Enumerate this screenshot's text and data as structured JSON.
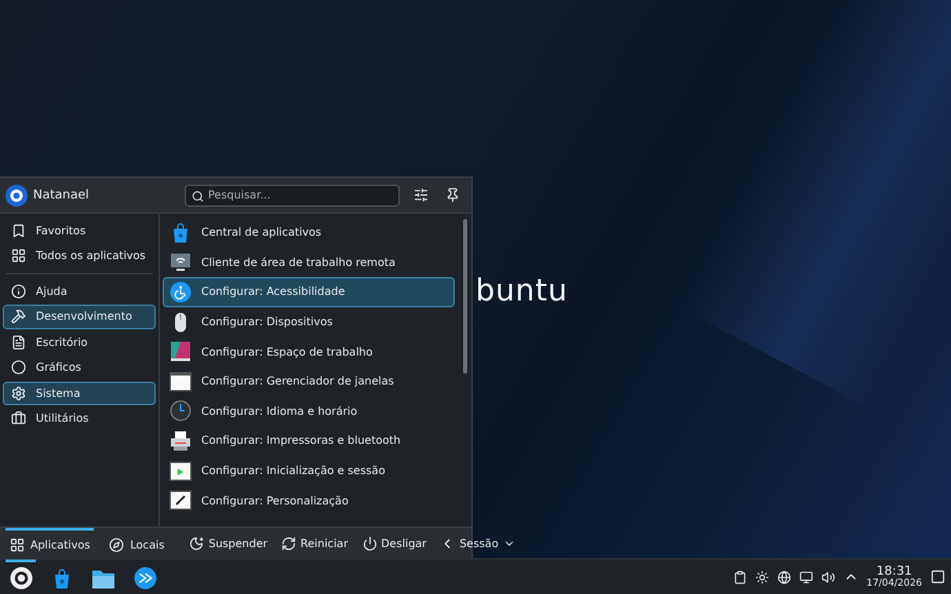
{
  "wallpaper": {
    "logo_text": "buntu"
  },
  "launcher": {
    "user": "Natanael",
    "search": {
      "placeholder": "Pesquisar..."
    },
    "sidebar": [
      {
        "label": "Favoritos",
        "highlighted": false
      },
      {
        "label": "Todos os aplicativos",
        "highlighted": false
      },
      {
        "label": "Ajuda",
        "highlighted": false
      },
      {
        "label": "Desenvolvimento",
        "highlighted": true
      },
      {
        "label": "Escritório",
        "highlighted": false
      },
      {
        "label": "Gráficos",
        "highlighted": false
      },
      {
        "label": "Sistema",
        "highlighted": true
      },
      {
        "label": "Utilitários",
        "highlighted": false
      }
    ],
    "apps": [
      {
        "label": "Central de aplicativos",
        "selected": false
      },
      {
        "label": "Cliente de área de trabalho remota",
        "selected": false
      },
      {
        "label": "Configurar: Acessibilidade",
        "selected": true
      },
      {
        "label": "Configurar: Dispositivos",
        "selected": false
      },
      {
        "label": "Configurar: Espaço de trabalho",
        "selected": false
      },
      {
        "label": "Configurar: Gerenciador de janelas",
        "selected": false
      },
      {
        "label": "Configurar: Idioma e horário",
        "selected": false
      },
      {
        "label": "Configurar: Impressoras e bluetooth",
        "selected": false
      },
      {
        "label": "Configurar: Inicialização e sessão",
        "selected": false
      },
      {
        "label": "Configurar: Personalização",
        "selected": false
      }
    ],
    "tabs": [
      {
        "label": "Aplicativos",
        "selected": true
      },
      {
        "label": "Locais",
        "selected": false
      }
    ],
    "power": [
      {
        "label": "Suspender"
      },
      {
        "label": "Reiniciar"
      },
      {
        "label": "Desligar"
      },
      {
        "label": "Sessão"
      }
    ]
  },
  "taskbar": {
    "apps": [
      {
        "active": true
      },
      {
        "active": false
      },
      {
        "active": false
      },
      {
        "active": false
      }
    ],
    "clock": {
      "time": "18:31",
      "date": "17/04/2026"
    }
  }
}
